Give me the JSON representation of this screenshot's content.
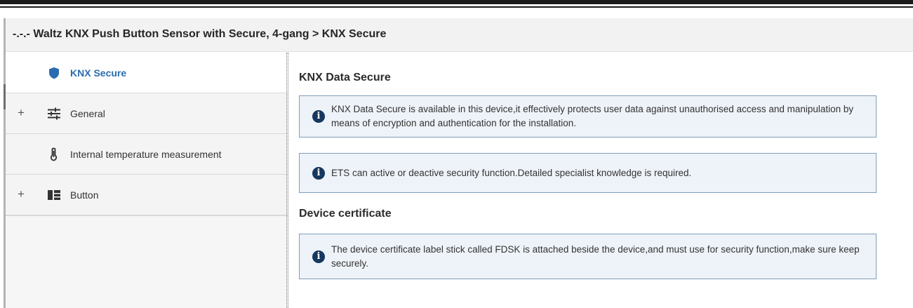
{
  "window": {
    "title": "-.-.- Waltz KNX Push Button Sensor with Secure, 4-gang > KNX Secure"
  },
  "sidebar": {
    "items": [
      {
        "label": "KNX Secure",
        "icon": "shield-icon",
        "expander": "",
        "active": true
      },
      {
        "label": "General",
        "icon": "sliders-icon",
        "expander": "+",
        "active": false
      },
      {
        "label": "Internal temperature measurement",
        "icon": "thermometer-icon",
        "expander": "",
        "active": false
      },
      {
        "label": "Button",
        "icon": "button-layout-icon",
        "expander": "+",
        "active": false
      }
    ]
  },
  "content": {
    "sections": [
      {
        "title": "KNX Data Secure",
        "notes": [
          "KNX Data Secure is available in this device,it effectively protects user data against unauthorised access and manipulation by means of encryption and authentication for the installation.",
          "ETS can active or deactive security function.Detailed specialist knowledge is required."
        ]
      },
      {
        "title": "Device certificate",
        "notes": [
          "The device certificate label stick called FDSK is attached beside the device,and must use for security function,make sure keep securely."
        ]
      }
    ]
  },
  "colors": {
    "accent": "#2b6cb0",
    "info_icon": "#17375e",
    "info_background": "#eef3f9",
    "info_border": "#7f9db9",
    "header_background": "#f2f2f2"
  }
}
